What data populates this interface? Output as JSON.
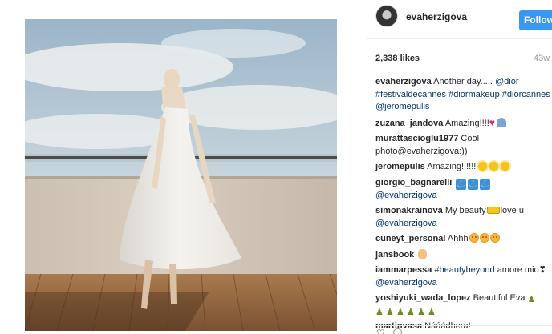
{
  "post": {
    "username": "evaherzigova",
    "follow_label": "Follow",
    "likes": "2,338 likes",
    "age": "43w"
  },
  "comments": [
    {
      "user": "evaherzigova",
      "text": "Another day..... ",
      "links": [
        "@dior",
        "#festivaldecannes",
        "#diormakeup",
        "#diorcannes",
        "@jeromepulis"
      ]
    },
    {
      "user": "zuzana_jandova",
      "text": "Amazing!!!!"
    },
    {
      "user": "murattascioglu1977",
      "text": "Cool photo@evaherzigova:))"
    },
    {
      "user": "jeromepulis",
      "text": "Amazing!!!!!!"
    },
    {
      "user": "giorgio_bagnarelli",
      "link": "@evaherzigova"
    },
    {
      "user": "simonakrainova",
      "text": "My beauty",
      "text_after": "love u",
      "link": "@evaherzigova"
    },
    {
      "user": "cuneyt_personal",
      "text": "Ahhh"
    },
    {
      "user": "jansbook"
    },
    {
      "user": "iammarpessa",
      "link": "#beautybeyond",
      "text": "amore mio❣",
      "link2": "@evaherzigova"
    },
    {
      "user": "yoshiyuki_wada_lopez",
      "text": "Beautiful Eva"
    },
    {
      "user": "martinvasa",
      "text": "Nááádhera!"
    }
  ],
  "icons": {
    "avatar": "avatar",
    "like": "heart-icon",
    "comment": "comment-icon"
  },
  "colors": {
    "follow_button": "#3897f0",
    "link": "#003569"
  }
}
